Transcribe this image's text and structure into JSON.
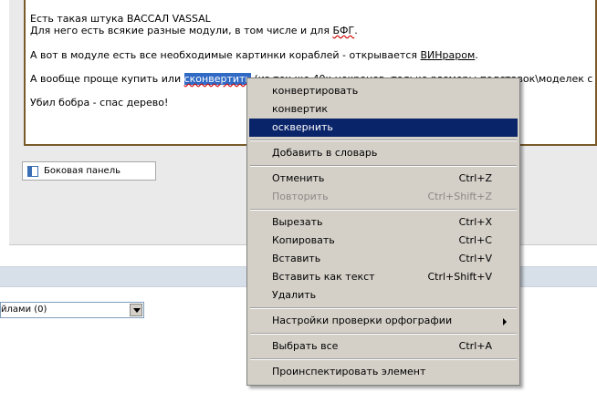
{
  "editor": {
    "line1": "Есть такая штука ВАССАЛ VASSAL",
    "line2_prefix": "Для него есть всякие разные модули, в том числе и для ",
    "line2_link": "БФГ",
    "line2_suffix": ".",
    "line3_prefix": "А вот в модуле есть все необходимые картинки кораблей - открывается ",
    "line3_link": "ВИНраром",
    "line3_suffix": ".",
    "line4_prefix": "А вообще проще купить или ",
    "line4_selected": "сконвертить",
    "line4_suffix": " (из тех же 40к некронов, только размеры подставок\\моделек с",
    "line5": "Убил бобра - спас дерево!"
  },
  "sidebar_button": {
    "label": "Боковая панель"
  },
  "select": {
    "value": "йлами (0)"
  },
  "context_menu": {
    "suggestions": [
      "конвертировать",
      "конвертик",
      "осквернить"
    ],
    "add_to_dictionary": "Добавить в словарь",
    "undo": {
      "label": "Отменить",
      "shortcut": "Ctrl+Z"
    },
    "redo": {
      "label": "Повторить",
      "shortcut": "Ctrl+Shift+Z"
    },
    "cut": {
      "label": "Вырезать",
      "shortcut": "Ctrl+X"
    },
    "copy": {
      "label": "Копировать",
      "shortcut": "Ctrl+C"
    },
    "paste": {
      "label": "Вставить",
      "shortcut": "Ctrl+V"
    },
    "paste_text": {
      "label": "Вставить как текст",
      "shortcut": "Ctrl+Shift+V"
    },
    "delete": {
      "label": "Удалить"
    },
    "spellcheck_settings": {
      "label": "Настройки проверки орфографии"
    },
    "select_all": {
      "label": "Выбрать все",
      "shortcut": "Ctrl+A"
    },
    "inspect": {
      "label": "Проинспектировать элемент"
    }
  }
}
